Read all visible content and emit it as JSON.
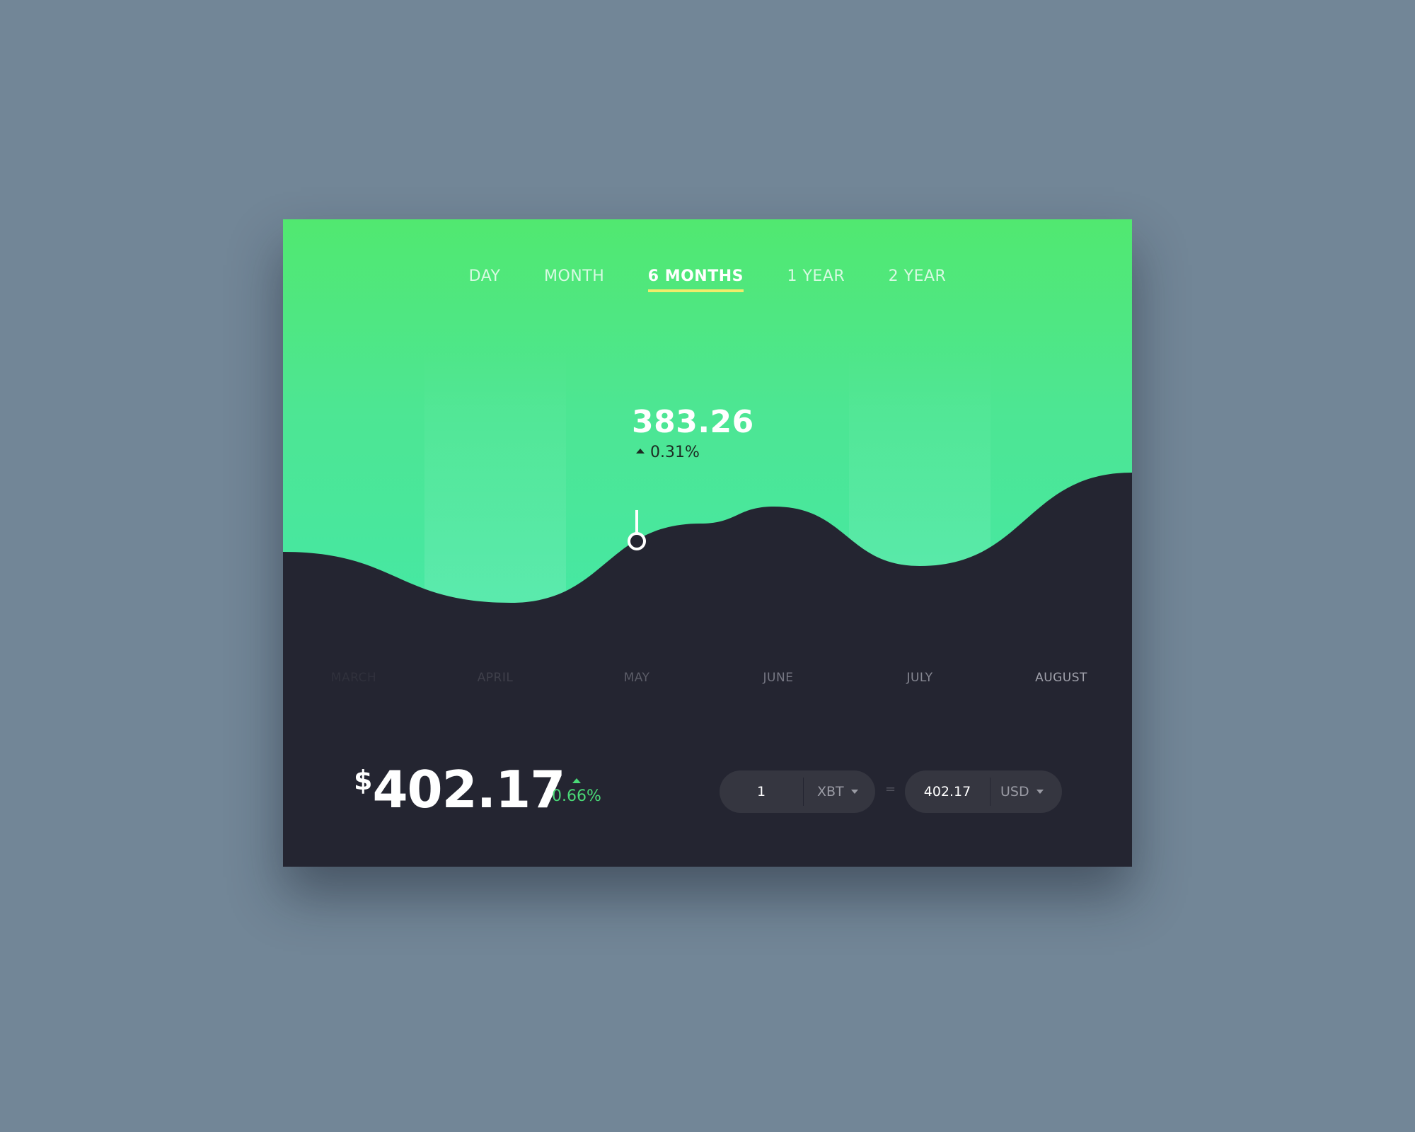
{
  "tabs": {
    "day": "DAY",
    "month": "MONTH",
    "six_months": "6 MONTHS",
    "one_year": "1 YEAR",
    "two_year": "2 YEAR",
    "active": "6 MONTHS"
  },
  "tooltip": {
    "value": "383.26",
    "change": "0.31%",
    "month": "MAY"
  },
  "price": {
    "currency": "$",
    "value": "402.17",
    "change": "0.66%"
  },
  "converter": {
    "from_amount": "1",
    "from_unit": "XBT",
    "equals": "=",
    "to_amount": "402.17",
    "to_unit": "USD"
  },
  "colors": {
    "accent_green": "#4ad977",
    "tab_underline": "#f2ec6a",
    "card_dark": "#242531",
    "gradient_top": "#51e870",
    "gradient_bottom": "#45e8a6"
  },
  "chart_data": {
    "type": "area",
    "categories": [
      "MARCH",
      "APRIL",
      "MAY",
      "JUNE",
      "JULY",
      "AUGUST"
    ],
    "values": [
      370,
      352,
      380,
      386,
      365,
      398
    ],
    "highlight": {
      "category": "MAY",
      "value": 383.26,
      "change": "0.31%"
    },
    "ylim": [
      330,
      410
    ],
    "grid": false
  }
}
